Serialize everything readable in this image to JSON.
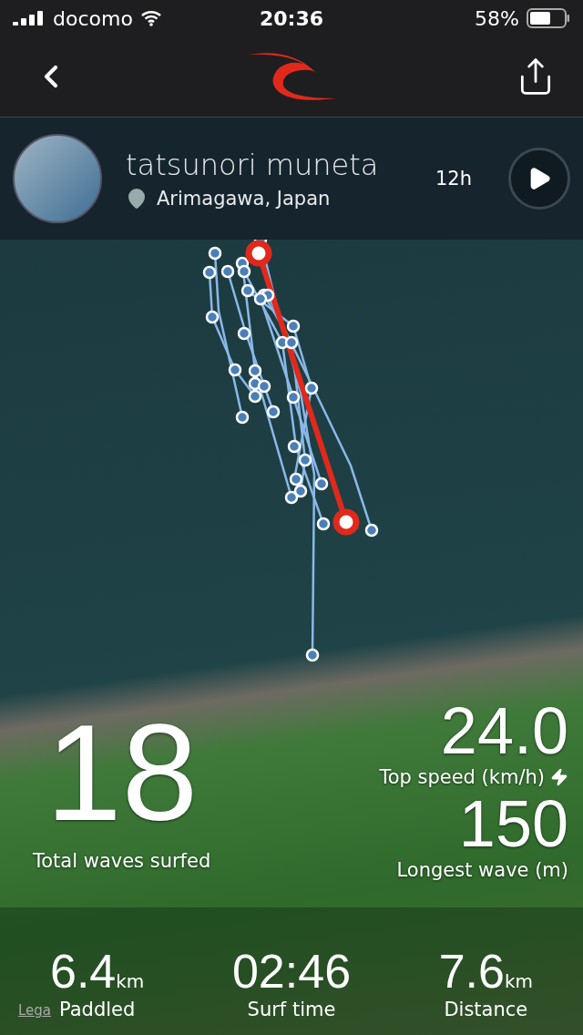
{
  "status_bar": {
    "carrier": "docomo",
    "time": "20:36",
    "battery": "58%"
  },
  "profile": {
    "name": "tatsunori muneta",
    "location": "Arimagawa, Japan",
    "duration": "12h"
  },
  "main_stat": {
    "value": "18",
    "label": "Total waves surfed"
  },
  "side_stats": [
    {
      "value": "24.0",
      "label": "Top speed (km/h)",
      "kind": "speed"
    },
    {
      "value": "150",
      "label": "Longest wave (m)",
      "kind": "plain"
    }
  ],
  "bottom_stats": [
    {
      "value": "6.4",
      "unit": "km",
      "label": "Paddled"
    },
    {
      "value": "02:46",
      "label": "Surf time"
    },
    {
      "value": "7.6",
      "unit": "km",
      "label": "Distance"
    }
  ],
  "legal_link": "Lega"
}
